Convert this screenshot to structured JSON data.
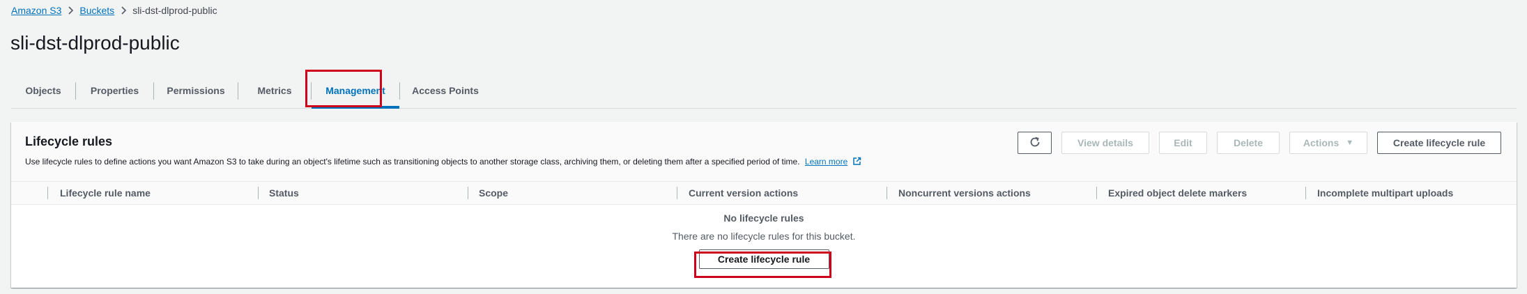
{
  "breadcrumb": {
    "items": [
      "Amazon S3",
      "Buckets"
    ],
    "current": "sli-dst-dlprod-public"
  },
  "page": {
    "title": "sli-dst-dlprod-public"
  },
  "tabs": [
    {
      "label": "Objects"
    },
    {
      "label": "Properties"
    },
    {
      "label": "Permissions"
    },
    {
      "label": "Metrics"
    },
    {
      "label": "Management"
    },
    {
      "label": "Access Points"
    }
  ],
  "active_tab": "Management",
  "lifecycle": {
    "title": "Lifecycle rules",
    "description": "Use lifecycle rules to define actions you want Amazon S3 to take during an object's lifetime such as transitioning objects to another storage class, archiving them, or deleting them after a specified period of time.",
    "learn_more": "Learn more",
    "buttons": {
      "refresh_icon": "refresh-icon",
      "view_details": "View details",
      "edit": "Edit",
      "delete": "Delete",
      "actions": "Actions",
      "create": "Create lifecycle rule"
    },
    "columns": [
      "Lifecycle rule name",
      "Status",
      "Scope",
      "Current version actions",
      "Noncurrent versions actions",
      "Expired object delete markers",
      "Incomplete multipart uploads"
    ],
    "empty": {
      "title": "No lifecycle rules",
      "description": "There are no lifecycle rules for this bucket.",
      "button": "Create lifecycle rule"
    }
  },
  "colors": {
    "link": "#0073bb",
    "highlight": "#d0021b",
    "background": "#f2f3f3"
  }
}
